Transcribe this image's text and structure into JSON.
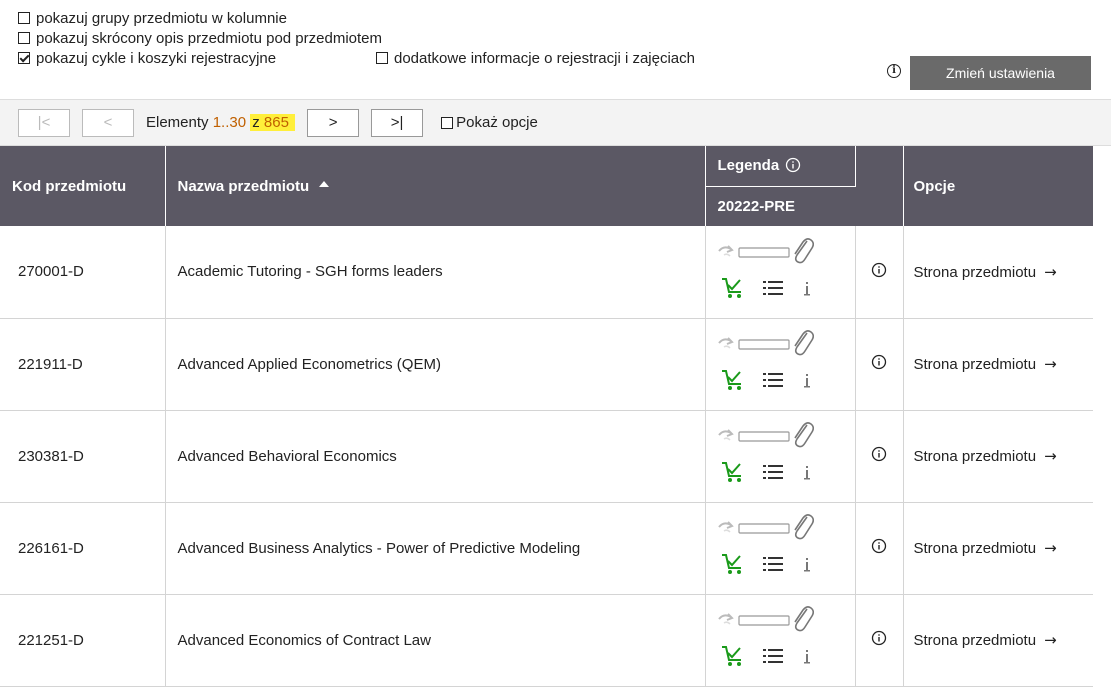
{
  "settings": {
    "options": [
      {
        "label": "pokazuj grupy przedmiotu w kolumnie",
        "checked": false
      },
      {
        "label": "pokazuj skrócony opis przedmiotu pod przedmiotem",
        "checked": false
      },
      {
        "label": "pokazuj cykle i koszyki rejestracyjne",
        "checked": true
      },
      {
        "label": "dodatkowe informacje o rejestracji i zajęciach",
        "checked": false
      }
    ],
    "change_button": "Zmień ustawienia",
    "info_glyph": "i"
  },
  "pager": {
    "first_symbol": "|<",
    "prev_symbol": "<",
    "elements_label": "Elementy",
    "range": "1..30",
    "of": "z",
    "total": "865",
    "next_symbol": ">",
    "last_symbol": ">|",
    "show_options": "Pokaż opcje"
  },
  "table": {
    "headers": {
      "code": "Kod przedmiotu",
      "name": "Nazwa przedmiotu",
      "legend": "Legenda",
      "cycle": "20222-PRE",
      "options": "Opcje"
    },
    "rows": [
      {
        "code": "270001-D",
        "name": "Academic Tutoring - SGH forms leaders",
        "link": "Strona przedmiotu"
      },
      {
        "code": "221911-D",
        "name": "Advanced Applied Econometrics (QEM)",
        "link": "Strona przedmiotu"
      },
      {
        "code": "230381-D",
        "name": "Advanced Behavioral Economics",
        "link": "Strona przedmiotu"
      },
      {
        "code": "226161-D",
        "name": "Advanced Business Analytics - Power of Predictive Modeling",
        "link": "Strona przedmiotu"
      },
      {
        "code": "221251-D",
        "name": "Advanced Economics of Contract Law",
        "link": "Strona przedmiotu"
      }
    ],
    "link_arrow": "→"
  },
  "icons": {
    "registration": "redo-arrow-icon",
    "progress": "empty-bar-icon",
    "attachment": "paperclip-icon",
    "cart": "cart-check-icon",
    "list": "list-icon",
    "info_small": "info-letter-icon",
    "info": "info-circle-icon",
    "cart_color": "#1a9a1a",
    "header_bg": "#5b5864",
    "highlight": "#ffef3a",
    "accent_number": "#c06000"
  }
}
